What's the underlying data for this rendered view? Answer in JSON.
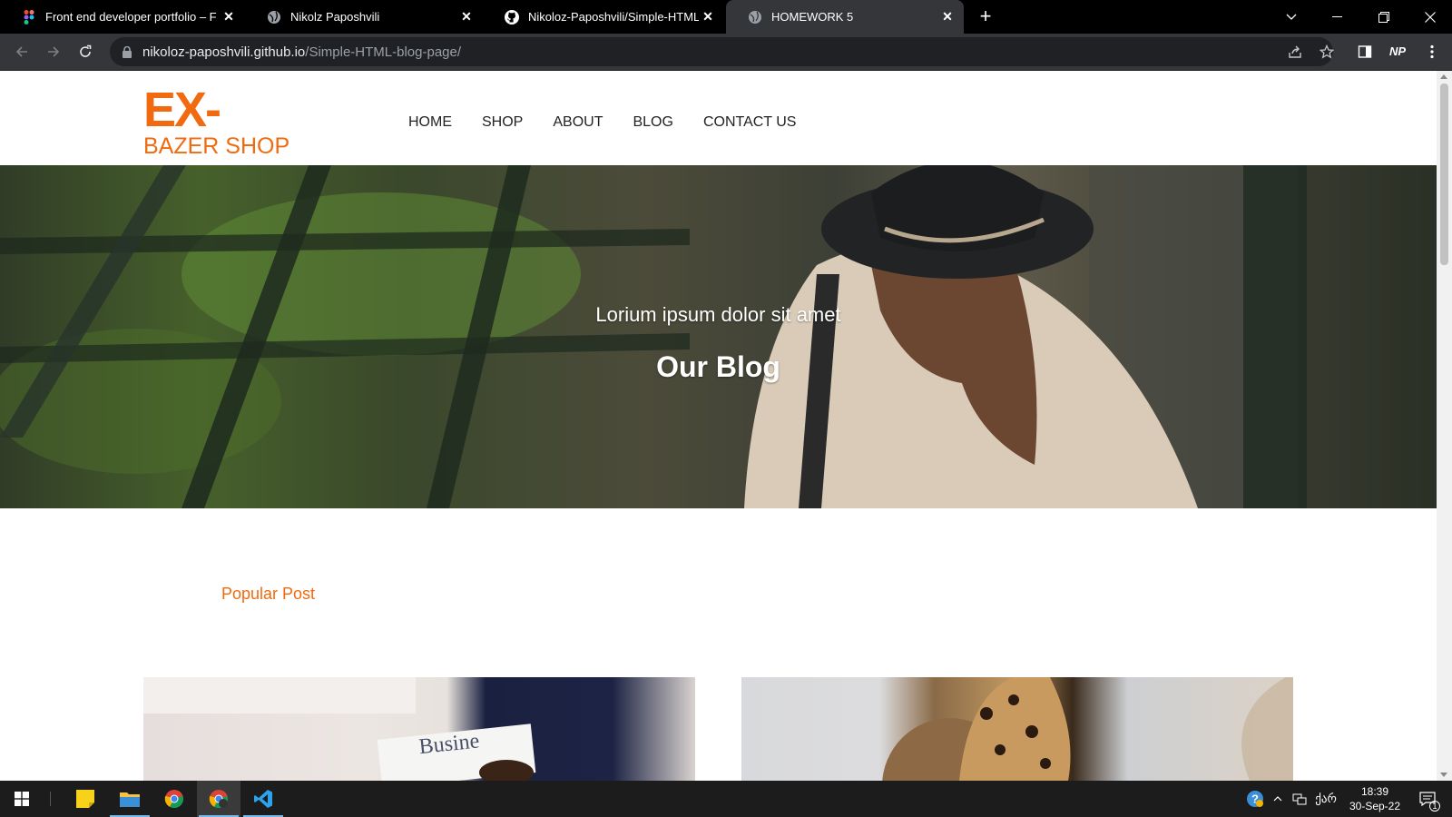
{
  "browser": {
    "tabs": [
      {
        "title": "Front end developer portfolio – F",
        "icon": "figma-icon",
        "active": false
      },
      {
        "title": "Nikolz Paposhvili",
        "icon": "globe-icon",
        "active": false
      },
      {
        "title": "Nikoloz-Paposhvili/Simple-HTML",
        "icon": "github-icon",
        "active": false
      },
      {
        "title": "HOMEWORK 5",
        "icon": "globe-icon",
        "active": true
      }
    ],
    "url_host": "nikoloz-paposhvili.github.io",
    "url_path": "/Simple-HTML-blog-page/",
    "profile_initials": "NP"
  },
  "site": {
    "logo_line1": "EX-",
    "logo_line2": "BAZER SHOP",
    "nav": [
      "HOME",
      "SHOP",
      "ABOUT",
      "BLOG",
      "CONTACT US"
    ],
    "hero_subtitle": "Lorium ipsum dolor sit amet",
    "hero_title": "Our Blog",
    "popular_heading": "Popular Post",
    "accent_color": "#f26a0f"
  },
  "taskbar": {
    "time": "18:39",
    "date": "30-Sep-22",
    "lang": "ქარ",
    "notifications": "1"
  }
}
